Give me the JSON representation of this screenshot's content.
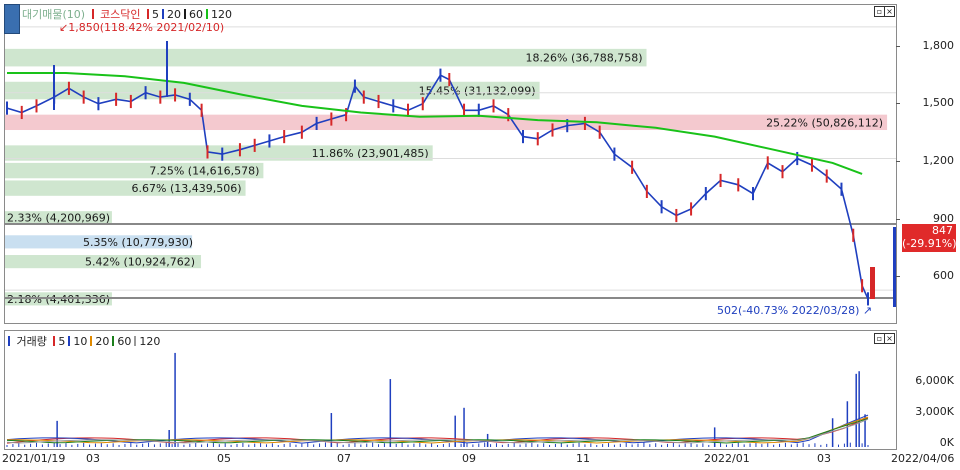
{
  "legend_price": {
    "title": "대기매물(10)",
    "index": "코스닥인",
    "ma": [
      {
        "label": "5",
        "color": "#d62728"
      },
      {
        "label": "20",
        "color": "#1f3fbf"
      },
      {
        "label": "60",
        "color": "#1b1b1b"
      },
      {
        "label": "120",
        "color": "#19c219"
      }
    ]
  },
  "legend_volume": {
    "title": "거래량",
    "ma": [
      {
        "label": "5",
        "color": "#d62728"
      },
      {
        "label": "10",
        "color": "#1f3fbf"
      },
      {
        "label": "20",
        "color": "#e08a00"
      },
      {
        "label": "60",
        "color": "#1b7f1b"
      },
      {
        "label": "120",
        "color": "#999999"
      }
    ]
  },
  "price_axis": [
    "1,800",
    "1,500",
    "1,200",
    "900",
    "600"
  ],
  "volume_axis": [
    "6,000K",
    "3,000K",
    "0K"
  ],
  "x_labels": [
    "2021/01/19",
    "03",
    "05",
    "07",
    "09",
    "11",
    "2022/01",
    "03",
    "2022/04/06"
  ],
  "annotations": {
    "high": "1,850(118.42% 2021/02/10)",
    "low": "502(-40.73% 2022/03/28)",
    "current_price": "847",
    "current_change": "(-29.91%)"
  },
  "chart_data": {
    "type": "bar",
    "title": "대기매물(10)",
    "bands": [
      {
        "price_low": 1620,
        "price_high": 1700,
        "label": "18.26% (36,788,758)",
        "pct": 18.26,
        "volume": 36788758,
        "color": "#cfe6cf"
      },
      {
        "price_low": 1470,
        "price_high": 1550,
        "label": "15.45% (31,132,099)",
        "pct": 15.45,
        "volume": 31132099,
        "color": "#cfe6cf"
      },
      {
        "price_low": 1330,
        "price_high": 1400,
        "label": "25.22% (50,826,112)",
        "pct": 25.22,
        "volume": 50826112,
        "color": "#f4c9cf"
      },
      {
        "price_low": 1190,
        "price_high": 1260,
        "label": "11.86% (23,901,485)",
        "pct": 11.86,
        "volume": 23901485,
        "color": "#cfe6cf"
      },
      {
        "price_low": 1110,
        "price_high": 1180,
        "label": "7.25% (14,616,578)",
        "pct": 7.25,
        "volume": 14616578,
        "color": "#cfe6cf"
      },
      {
        "price_low": 1030,
        "price_high": 1100,
        "label": "6.67% (13,439,506)",
        "pct": 6.67,
        "volume": 13439506,
        "color": "#cfe6cf"
      },
      {
        "price_low": 900,
        "price_high": 960,
        "label": "2.33% (4,200,969)",
        "pct": 2.33,
        "volume": 4200969,
        "color": "#cfe6cf"
      },
      {
        "price_low": 790,
        "price_high": 850,
        "label": "5.35% (10,779,930)",
        "pct": 5.35,
        "volume": 10779930,
        "color": "#c9dff0"
      },
      {
        "price_low": 700,
        "price_high": 760,
        "label": "5.42% (10,924,762)",
        "pct": 5.42,
        "volume": 10924762,
        "color": "#cfe6cf"
      },
      {
        "price_low": 530,
        "price_high": 590,
        "label": "2.18% (4,401,336)",
        "pct": 2.18,
        "volume": 4401336,
        "color": "#cfe6cf"
      }
    ],
    "price_trend": [
      [
        0,
        1430
      ],
      [
        5,
        1410
      ],
      [
        10,
        1440
      ],
      [
        16,
        1480
      ],
      [
        21,
        1520
      ],
      [
        26,
        1480
      ],
      [
        31,
        1450
      ],
      [
        37,
        1470
      ],
      [
        42,
        1460
      ],
      [
        47,
        1500
      ],
      [
        52,
        1480
      ],
      [
        57,
        1490
      ],
      [
        62,
        1470
      ],
      [
        66,
        1420
      ],
      [
        68,
        1230
      ],
      [
        73,
        1220
      ],
      [
        79,
        1240
      ],
      [
        84,
        1260
      ],
      [
        89,
        1280
      ],
      [
        94,
        1300
      ],
      [
        100,
        1320
      ],
      [
        105,
        1360
      ],
      [
        110,
        1380
      ],
      [
        115,
        1400
      ],
      [
        118,
        1530
      ],
      [
        121,
        1480
      ],
      [
        126,
        1460
      ],
      [
        131,
        1440
      ],
      [
        136,
        1420
      ],
      [
        141,
        1450
      ],
      [
        147,
        1580
      ],
      [
        150,
        1560
      ],
      [
        155,
        1420
      ],
      [
        160,
        1420
      ],
      [
        165,
        1440
      ],
      [
        170,
        1400
      ],
      [
        175,
        1300
      ],
      [
        180,
        1290
      ],
      [
        185,
        1330
      ],
      [
        190,
        1350
      ],
      [
        196,
        1360
      ],
      [
        201,
        1320
      ],
      [
        206,
        1220
      ],
      [
        212,
        1160
      ],
      [
        217,
        1050
      ],
      [
        222,
        980
      ],
      [
        227,
        940
      ],
      [
        232,
        970
      ],
      [
        237,
        1040
      ],
      [
        242,
        1100
      ],
      [
        248,
        1080
      ],
      [
        253,
        1040
      ],
      [
        258,
        1180
      ],
      [
        263,
        1140
      ],
      [
        268,
        1200
      ],
      [
        273,
        1170
      ],
      [
        278,
        1120
      ],
      [
        283,
        1060
      ],
      [
        287,
        850
      ],
      [
        290,
        620
      ],
      [
        292,
        560
      ]
    ],
    "ma120": [
      [
        0,
        1590
      ],
      [
        20,
        1590
      ],
      [
        40,
        1575
      ],
      [
        60,
        1545
      ],
      [
        80,
        1490
      ],
      [
        100,
        1440
      ],
      [
        120,
        1410
      ],
      [
        140,
        1390
      ],
      [
        160,
        1395
      ],
      [
        180,
        1375
      ],
      [
        200,
        1365
      ],
      [
        220,
        1340
      ],
      [
        240,
        1300
      ],
      [
        260,
        1240
      ],
      [
        280,
        1180
      ],
      [
        290,
        1130
      ]
    ],
    "current_price": 847,
    "ylim": [
      450,
      1900
    ],
    "volume_ylim": [
      0,
      7500
    ],
    "volume_spikes": [
      [
        17,
        2000
      ],
      [
        55,
        1300
      ],
      [
        57,
        7200
      ],
      [
        110,
        2600
      ],
      [
        130,
        5200
      ],
      [
        152,
        2400
      ],
      [
        155,
        3000
      ],
      [
        163,
        1000
      ],
      [
        240,
        1500
      ],
      [
        280,
        2200
      ],
      [
        285,
        3500
      ],
      [
        288,
        5600
      ],
      [
        289,
        5800
      ],
      [
        291,
        2500
      ]
    ]
  }
}
